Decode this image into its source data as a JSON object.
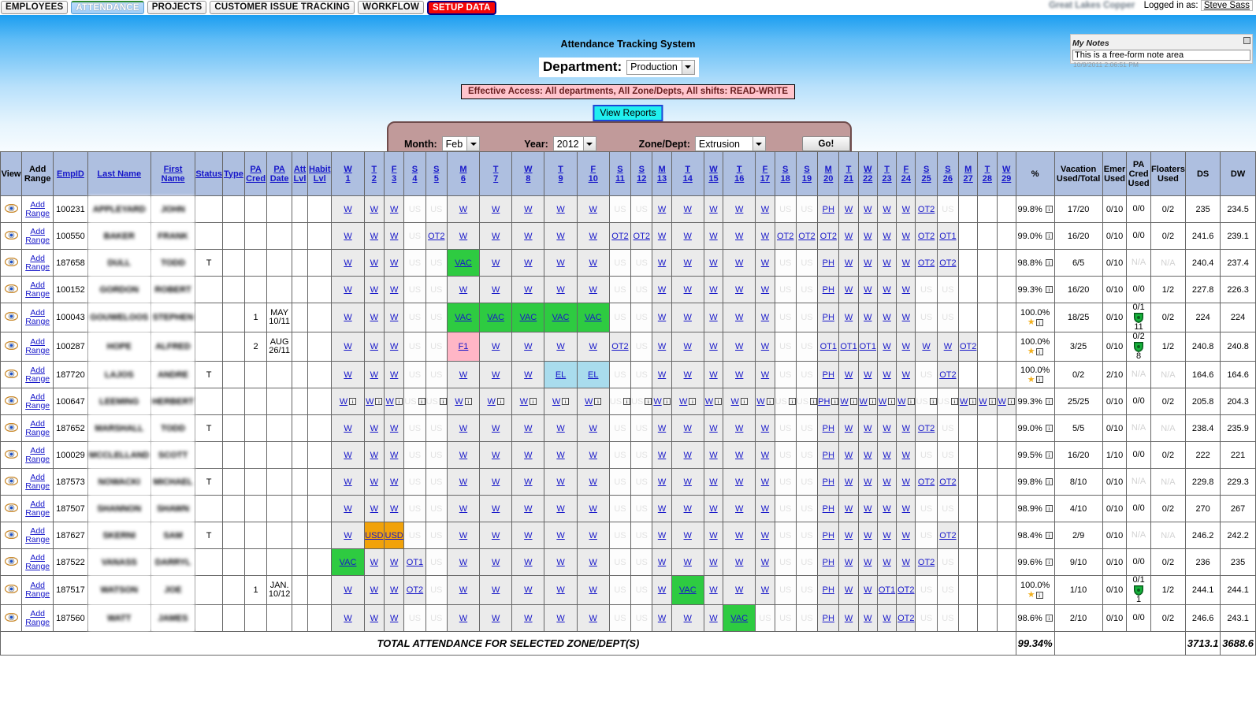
{
  "nav": {
    "tabs": [
      {
        "label": "EMPLOYEES",
        "state": "normal"
      },
      {
        "label": "ATTENDANCE",
        "state": "active"
      },
      {
        "label": "PROJECTS",
        "state": "normal"
      },
      {
        "label": "CUSTOMER ISSUE TRACKING",
        "state": "normal"
      },
      {
        "label": "WORKFLOW",
        "state": "normal"
      },
      {
        "label": "SETUP DATA",
        "state": "danger"
      }
    ],
    "company": "Great Lakes Copper",
    "logged_in_label": "Logged in as:",
    "user": "Steve Sass"
  },
  "notes": {
    "title": "My Notes",
    "value": "This is a free-form note area",
    "timestamp": "10/9/2011 2:06:51 PM"
  },
  "header": {
    "system_title": "Attendance Tracking System",
    "department_label": "Department:",
    "department_value": "Production",
    "access_text": "Effective Access: All departments, All Zone/Depts, All shifts: READ-WRITE",
    "view_reports_label": "View Reports"
  },
  "filters": {
    "month_label": "Month:",
    "month_value": "Feb",
    "year_label": "Year:",
    "year_value": "2012",
    "zone_label": "Zone/Dept:",
    "zone_value": "Extrusion",
    "go_label": "Go!"
  },
  "table": {
    "fixed_headers": [
      "View",
      "Add Range",
      "EmpID",
      "Last Name",
      "First Name",
      "Status",
      "Type",
      "PA Cred",
      "PA Date",
      "Att Lvl",
      "Habit Lvl"
    ],
    "day_headers": [
      {
        "dow": "W",
        "num": "1"
      },
      {
        "dow": "T",
        "num": "2"
      },
      {
        "dow": "F",
        "num": "3"
      },
      {
        "dow": "S",
        "num": "4"
      },
      {
        "dow": "S",
        "num": "5"
      },
      {
        "dow": "M",
        "num": "6"
      },
      {
        "dow": "T",
        "num": "7"
      },
      {
        "dow": "W",
        "num": "8"
      },
      {
        "dow": "T",
        "num": "9"
      },
      {
        "dow": "F",
        "num": "10"
      },
      {
        "dow": "S",
        "num": "11"
      },
      {
        "dow": "S",
        "num": "12"
      },
      {
        "dow": "M",
        "num": "13"
      },
      {
        "dow": "T",
        "num": "14"
      },
      {
        "dow": "W",
        "num": "15"
      },
      {
        "dow": "T",
        "num": "16"
      },
      {
        "dow": "F",
        "num": "17"
      },
      {
        "dow": "S",
        "num": "18"
      },
      {
        "dow": "S",
        "num": "19"
      },
      {
        "dow": "M",
        "num": "20"
      },
      {
        "dow": "T",
        "num": "21"
      },
      {
        "dow": "W",
        "num": "22"
      },
      {
        "dow": "T",
        "num": "23"
      },
      {
        "dow": "F",
        "num": "24"
      },
      {
        "dow": "S",
        "num": "25"
      },
      {
        "dow": "S",
        "num": "26"
      },
      {
        "dow": "M",
        "num": "27"
      },
      {
        "dow": "T",
        "num": "28"
      },
      {
        "dow": "W",
        "num": "29"
      }
    ],
    "summary_headers": [
      "%",
      "Vacation Used/Total",
      "Emer Used",
      "PA Cred Used",
      "Floaters Used",
      "DS",
      "DW"
    ],
    "add_range_label": "Add Range",
    "rows": [
      {
        "empid": "100231",
        "last": "APPLEYARD",
        "first": "JOHN",
        "status": "",
        "type": "",
        "pacred": "",
        "padate": "",
        "attlvl": "",
        "habitlvl": "",
        "days": [
          "W",
          "W",
          "W",
          "US",
          "US",
          "W",
          "W",
          "W",
          "W",
          "W",
          "US",
          "US",
          "W",
          "W",
          "W",
          "W",
          "W",
          "US",
          "US",
          "PH",
          "W",
          "W",
          "W",
          "W",
          "OT2",
          "US",
          "",
          "",
          ""
        ],
        "pct": "99.8%",
        "star": false,
        "vacation": "17/20",
        "emer": "0/10",
        "pacredused": "0/0",
        "pacredshield": null,
        "floaters": "0/2",
        "ds": "235",
        "dw": "234.5"
      },
      {
        "empid": "100550",
        "last": "BAKER",
        "first": "FRANK",
        "status": "",
        "type": "",
        "pacred": "",
        "padate": "",
        "attlvl": "",
        "habitlvl": "",
        "days": [
          "W",
          "W",
          "W",
          "US",
          "OT2",
          "W",
          "W",
          "W",
          "W",
          "W",
          "OT2",
          "OT2",
          "W",
          "W",
          "W",
          "W",
          "W",
          "OT2",
          "OT2",
          "OT2",
          "W",
          "W",
          "W",
          "W",
          "OT2",
          "OT1",
          "",
          "",
          ""
        ],
        "pct": "99.0%",
        "star": false,
        "vacation": "16/20",
        "emer": "0/10",
        "pacredused": "0/0",
        "pacredshield": null,
        "floaters": "0/2",
        "ds": "241.6",
        "dw": "239.1"
      },
      {
        "empid": "187658",
        "last": "DULL",
        "first": "TODD",
        "status": "T",
        "type": "",
        "pacred": "",
        "padate": "",
        "attlvl": "",
        "habitlvl": "",
        "days": [
          "W",
          "W",
          "W",
          "US",
          "US",
          "VAC",
          "W",
          "W",
          "W",
          "W",
          "US",
          "US",
          "W",
          "W",
          "W",
          "W",
          "W",
          "US",
          "US",
          "PH",
          "W",
          "W",
          "W",
          "W",
          "OT2",
          "OT2",
          "",
          "",
          ""
        ],
        "pct": "98.8%",
        "star": false,
        "vacation": "6/5",
        "emer": "0/10",
        "pacredused": "N/A",
        "pacredshield": null,
        "floaters": "N/A",
        "ds": "240.4",
        "dw": "237.4"
      },
      {
        "empid": "100152",
        "last": "GORDON",
        "first": "ROBERT",
        "status": "",
        "type": "",
        "pacred": "",
        "padate": "",
        "attlvl": "",
        "habitlvl": "",
        "days": [
          "W",
          "W",
          "W",
          "US",
          "US",
          "W",
          "W",
          "W",
          "W",
          "W",
          "US",
          "US",
          "W",
          "W",
          "W",
          "W",
          "W",
          "US",
          "US",
          "PH",
          "W",
          "W",
          "W",
          "W",
          "US",
          "US",
          "",
          "",
          ""
        ],
        "pct": "99.3%",
        "star": false,
        "vacation": "16/20",
        "emer": "0/10",
        "pacredused": "0/0",
        "pacredshield": null,
        "floaters": "1/2",
        "ds": "227.8",
        "dw": "226.3"
      },
      {
        "empid": "100043",
        "last": "GOUWELOOS",
        "first": "STEPHEN",
        "status": "",
        "type": "",
        "pacred": "1",
        "padate": "MAY 10/11",
        "attlvl": "",
        "habitlvl": "",
        "days": [
          "W",
          "W",
          "W",
          "US",
          "US",
          "VAC",
          "VAC",
          "VAC",
          "VAC",
          "VAC",
          "US",
          "US",
          "W",
          "W",
          "W",
          "W",
          "W",
          "US",
          "US",
          "PH",
          "W",
          "W",
          "W",
          "W",
          "US",
          "US",
          "",
          "",
          ""
        ],
        "pct": "100.0%",
        "star": true,
        "vacation": "18/25",
        "emer": "0/10",
        "pacredused": "0/1",
        "pacredshield": "11",
        "floaters": "0/2",
        "ds": "224",
        "dw": "224"
      },
      {
        "empid": "100287",
        "last": "HOPE",
        "first": "ALFRED",
        "status": "",
        "type": "",
        "pacred": "2",
        "padate": "AUG 26/11",
        "attlvl": "",
        "habitlvl": "",
        "days": [
          "W",
          "W",
          "W",
          "US",
          "US",
          "F1",
          "W",
          "W",
          "W",
          "W",
          "OT2",
          "US",
          "W",
          "W",
          "W",
          "W",
          "W",
          "US",
          "US",
          "OT1",
          "OT1",
          "OT1",
          "W",
          "W",
          "W",
          "W",
          "OT2",
          "",
          ""
        ],
        "pct": "100.0%",
        "star": true,
        "vacation": "3/25",
        "emer": "0/10",
        "pacredused": "0/2",
        "pacredshield": "8",
        "floaters": "1/2",
        "ds": "240.8",
        "dw": "240.8"
      },
      {
        "empid": "187720",
        "last": "LAJOS",
        "first": "ANDRE",
        "status": "T",
        "type": "",
        "pacred": "",
        "padate": "",
        "attlvl": "",
        "habitlvl": "",
        "days": [
          "W",
          "W",
          "W",
          "US",
          "US",
          "W",
          "W",
          "W",
          "EL",
          "EL",
          "US",
          "US",
          "W",
          "W",
          "W",
          "W",
          "W",
          "US",
          "US",
          "PH",
          "W",
          "W",
          "W",
          "W",
          "US",
          "OT2",
          "",
          "",
          ""
        ],
        "pct": "100.0%",
        "star": true,
        "vacation": "0/2",
        "emer": "2/10",
        "pacredused": "N/A",
        "pacredshield": null,
        "floaters": "N/A",
        "ds": "164.6",
        "dw": "164.6"
      },
      {
        "empid": "100647",
        "last": "LEEMING",
        "first": "HERBERT",
        "status": "",
        "type": "",
        "pacred": "",
        "padate": "",
        "attlvl": "",
        "habitlvl": "",
        "days": [
          "W",
          "W",
          "W",
          "US",
          "US",
          "W",
          "W",
          "W",
          "W",
          "W",
          "US",
          "US",
          "W",
          "W",
          "W",
          "W",
          "W",
          "US",
          "US",
          "PH",
          "W",
          "W",
          "W",
          "W",
          "US",
          "US",
          "W",
          "W",
          "W"
        ],
        "info_icons": true,
        "pct": "99.3%",
        "star": false,
        "vacation": "25/25",
        "emer": "0/10",
        "pacredused": "0/0",
        "pacredshield": null,
        "floaters": "0/2",
        "ds": "205.8",
        "dw": "204.3"
      },
      {
        "empid": "187652",
        "last": "MARSHALL",
        "first": "TODD",
        "status": "T",
        "type": "",
        "pacred": "",
        "padate": "",
        "attlvl": "",
        "habitlvl": "",
        "days": [
          "W",
          "W",
          "W",
          "US",
          "US",
          "W",
          "W",
          "W",
          "W",
          "W",
          "US",
          "US",
          "W",
          "W",
          "W",
          "W",
          "W",
          "US",
          "US",
          "PH",
          "W",
          "W",
          "W",
          "W",
          "OT2",
          "US",
          "",
          "",
          ""
        ],
        "pct": "99.0%",
        "star": false,
        "vacation": "5/5",
        "emer": "0/10",
        "pacredused": "N/A",
        "pacredshield": null,
        "floaters": "N/A",
        "ds": "238.4",
        "dw": "235.9"
      },
      {
        "empid": "100029",
        "last": "MCCLELLAND",
        "first": "SCOTT",
        "status": "",
        "type": "",
        "pacred": "",
        "padate": "",
        "attlvl": "",
        "habitlvl": "",
        "days": [
          "W",
          "W",
          "W",
          "US",
          "US",
          "W",
          "W",
          "W",
          "W",
          "W",
          "US",
          "US",
          "W",
          "W",
          "W",
          "W",
          "W",
          "US",
          "US",
          "PH",
          "W",
          "W",
          "W",
          "W",
          "US",
          "US",
          "",
          "",
          ""
        ],
        "pct": "99.5%",
        "star": false,
        "vacation": "16/20",
        "emer": "1/10",
        "pacredused": "0/0",
        "pacredshield": null,
        "floaters": "0/2",
        "ds": "222",
        "dw": "221"
      },
      {
        "empid": "187573",
        "last": "NOWACKI",
        "first": "MICHAEL",
        "status": "T",
        "type": "",
        "pacred": "",
        "padate": "",
        "attlvl": "",
        "habitlvl": "",
        "days": [
          "W",
          "W",
          "W",
          "US",
          "US",
          "W",
          "W",
          "W",
          "W",
          "W",
          "US",
          "US",
          "W",
          "W",
          "W",
          "W",
          "W",
          "US",
          "US",
          "PH",
          "W",
          "W",
          "W",
          "W",
          "OT2",
          "OT2",
          "",
          "",
          ""
        ],
        "pct": "99.8%",
        "star": false,
        "vacation": "8/10",
        "emer": "0/10",
        "pacredused": "N/A",
        "pacredshield": null,
        "floaters": "N/A",
        "ds": "229.8",
        "dw": "229.3"
      },
      {
        "empid": "187507",
        "last": "SHANNON",
        "first": "SHAWN",
        "status": "",
        "type": "",
        "pacred": "",
        "padate": "",
        "attlvl": "",
        "habitlvl": "",
        "days": [
          "W",
          "W",
          "W",
          "US",
          "US",
          "W",
          "W",
          "W",
          "W",
          "W",
          "US",
          "US",
          "W",
          "W",
          "W",
          "W",
          "W",
          "US",
          "US",
          "PH",
          "W",
          "W",
          "W",
          "W",
          "US",
          "US",
          "",
          "",
          ""
        ],
        "pct": "98.9%",
        "star": false,
        "vacation": "4/10",
        "emer": "0/10",
        "pacredused": "0/0",
        "pacredshield": null,
        "floaters": "0/2",
        "ds": "270",
        "dw": "267"
      },
      {
        "empid": "187627",
        "last": "SKERNI",
        "first": "SAM",
        "status": "T",
        "type": "",
        "pacred": "",
        "padate": "",
        "attlvl": "",
        "habitlvl": "",
        "days": [
          "W",
          "USD",
          "USD",
          "US",
          "US",
          "W",
          "W",
          "W",
          "W",
          "W",
          "US",
          "US",
          "W",
          "W",
          "W",
          "W",
          "W",
          "US",
          "US",
          "PH",
          "W",
          "W",
          "W",
          "W",
          "US",
          "OT2",
          "",
          "",
          ""
        ],
        "pct": "98.4%",
        "star": false,
        "vacation": "2/9",
        "emer": "0/10",
        "pacredused": "N/A",
        "pacredshield": null,
        "floaters": "N/A",
        "ds": "246.2",
        "dw": "242.2"
      },
      {
        "empid": "187522",
        "last": "VANASS",
        "first": "DARRYL",
        "status": "",
        "type": "",
        "pacred": "",
        "padate": "",
        "attlvl": "",
        "habitlvl": "",
        "days": [
          "VAC",
          "W",
          "W",
          "OT1",
          "US",
          "W",
          "W",
          "W",
          "W",
          "W",
          "US",
          "US",
          "W",
          "W",
          "W",
          "W",
          "W",
          "US",
          "US",
          "PH",
          "W",
          "W",
          "W",
          "W",
          "OT2",
          "US",
          "",
          "",
          ""
        ],
        "pct": "99.6%",
        "star": false,
        "vacation": "9/10",
        "emer": "0/10",
        "pacredused": "0/0",
        "pacredshield": null,
        "floaters": "0/2",
        "ds": "236",
        "dw": "235"
      },
      {
        "empid": "187517",
        "last": "WATSON",
        "first": "JOE",
        "status": "",
        "type": "",
        "pacred": "1",
        "padate": "JAN. 10/12",
        "attlvl": "",
        "habitlvl": "",
        "days": [
          "W",
          "W",
          "W",
          "OT2",
          "US",
          "W",
          "W",
          "W",
          "W",
          "W",
          "US",
          "US",
          "W",
          "VAC",
          "W",
          "W",
          "W",
          "US",
          "US",
          "PH",
          "W",
          "W",
          "OT1",
          "OT2",
          "US",
          "US",
          "",
          "",
          ""
        ],
        "pct": "100.0%",
        "star": true,
        "vacation": "1/10",
        "emer": "0/10",
        "pacredused": "0/1",
        "pacredshield": "1",
        "floaters": "1/2",
        "ds": "244.1",
        "dw": "244.1"
      },
      {
        "empid": "187560",
        "last": "WATT",
        "first": "JAMES",
        "status": "",
        "type": "",
        "pacred": "",
        "padate": "",
        "attlvl": "",
        "habitlvl": "",
        "days": [
          "W",
          "W",
          "W",
          "US",
          "US",
          "W",
          "W",
          "W",
          "W",
          "W",
          "US",
          "US",
          "W",
          "W",
          "W",
          "VAC",
          "US",
          "US",
          "US",
          "PH",
          "W",
          "W",
          "W",
          "OT2",
          "US",
          "US",
          "",
          "",
          ""
        ],
        "pct": "98.6%",
        "star": false,
        "vacation": "2/10",
        "emer": "0/10",
        "pacredused": "0/0",
        "pacredshield": null,
        "floaters": "0/2",
        "ds": "246.6",
        "dw": "243.1"
      }
    ],
    "total": {
      "label": "TOTAL ATTENDANCE FOR SELECTED ZONE/DEPT(S)",
      "pct": "99.34%",
      "ds": "3713.1",
      "dw": "3688.6"
    }
  }
}
